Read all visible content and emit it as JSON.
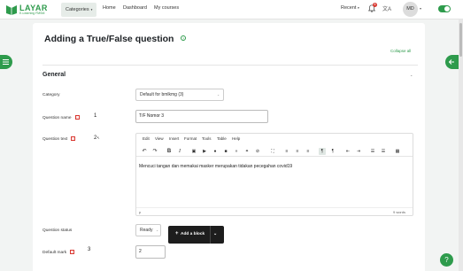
{
  "brand": {
    "name": "LAYAR",
    "tagline": "E-Learning FMSM",
    "color": "#2e9b4c"
  },
  "nav": {
    "categories": "Categories",
    "home": "Home",
    "dashboard": "Dashboard",
    "courses": "My courses",
    "recent": "Recent",
    "notifications_count": "8",
    "avatar": "MD"
  },
  "page": {
    "title": "Adding a True/False question",
    "collapse_all": "Collapse all",
    "section": "General"
  },
  "form": {
    "category_label": "Category",
    "category_value": "Default for bmlkmg (3)",
    "qname_label": "Question name",
    "qname_value": "T/F Nomor 3",
    "qtext_label": "Question text",
    "status_label": "Question status",
    "status_value": "Ready",
    "mark_label": "Default mark",
    "mark_value": "2"
  },
  "annotations": {
    "a1": "1",
    "a2": "2",
    "a3": "3"
  },
  "editor": {
    "menu": [
      "Edit",
      "View",
      "Insert",
      "Format",
      "Tools",
      "Table",
      "Help"
    ],
    "content": "Mencuci tangan dan memakai masker merupakan tidakan pecegahan covid19",
    "path": "p",
    "word_count": "9 words"
  },
  "add_block": {
    "label": "Add a block"
  }
}
